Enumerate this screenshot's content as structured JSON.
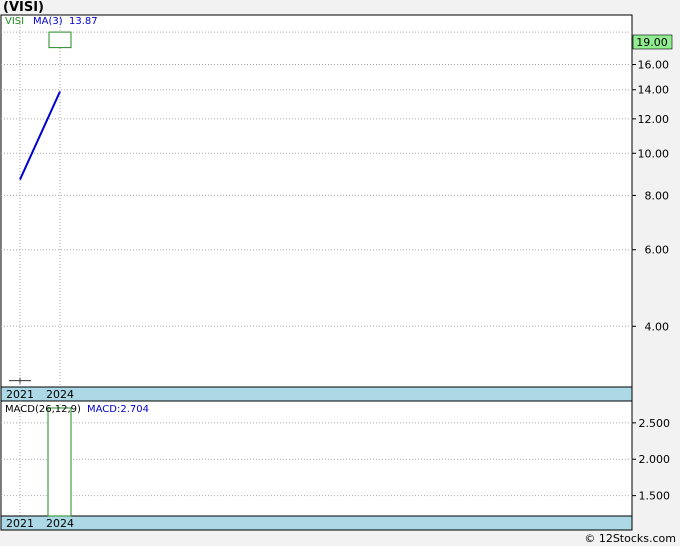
{
  "title": "(VISI)",
  "watermark": "© 12Stocks.com",
  "colors": {
    "price_box": "#228b22",
    "last_price_bg": "#90ee90",
    "ma_line": "#0000cc",
    "macd_bar": "#228b22",
    "axis_band": "#add8e6",
    "grid": "#aaaaaa"
  },
  "chart_data": [
    {
      "type": "line",
      "legend": {
        "ticker": "VISI",
        "ma_label": "MA(3)",
        "ma_value": "13.87"
      },
      "last_price_label": "19.00",
      "yscale": "log",
      "ylim": [
        2.9,
        20.8
      ],
      "yticks": [
        "16.00",
        "14.00",
        "12.00",
        "10.00",
        "8.00",
        "6.00",
        "4.00"
      ],
      "xticks": [
        "2021",
        "2024"
      ],
      "price_bars": [
        {
          "x": "2021",
          "open": 3.0,
          "high": 3.0,
          "low": 3.0,
          "close": 3.0
        },
        {
          "x": "2024",
          "open": 17.5,
          "high": 19.0,
          "low": 17.5,
          "close": 19.0
        }
      ],
      "ma_series": {
        "name": "MA(3)",
        "x": [
          "2021",
          "2024"
        ],
        "values": [
          8.7,
          13.87
        ]
      },
      "grid": true
    },
    {
      "type": "bar",
      "legend": {
        "label": "MACD(26,12,9)",
        "value_label": "MACD:2.704"
      },
      "ylim": [
        1.22,
        2.8
      ],
      "yticks": [
        "2.500",
        "2.000",
        "1.500"
      ],
      "xticks": [
        "2021",
        "2024"
      ],
      "categories": [
        "2024"
      ],
      "values": [
        2.704
      ],
      "grid": true
    }
  ]
}
